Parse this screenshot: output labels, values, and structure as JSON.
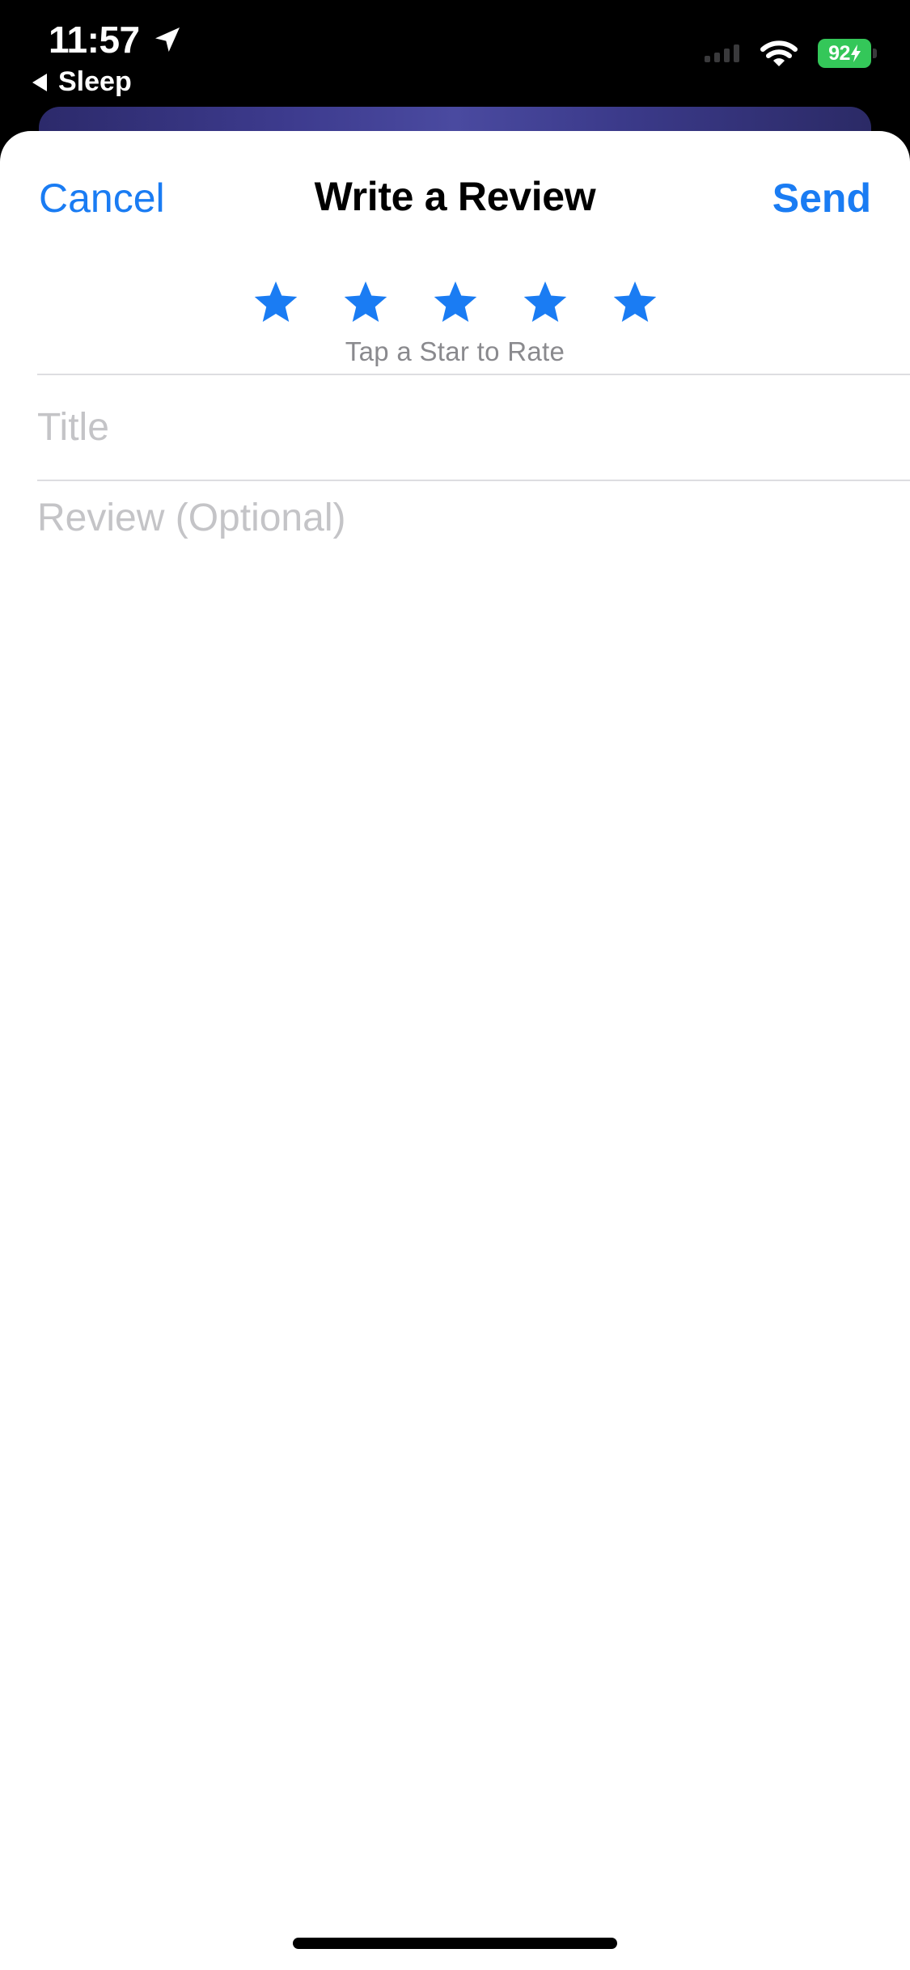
{
  "status_bar": {
    "time": "11:57",
    "location_icon": "location-arrow-icon",
    "back_label": "Sleep",
    "signal_icon": "cellular-signal-icon",
    "wifi_icon": "wifi-icon",
    "battery_level": "92",
    "battery_charging": true,
    "battery_color": "#34C759"
  },
  "nav": {
    "cancel_label": "Cancel",
    "title": "Write a Review",
    "send_label": "Send"
  },
  "rating": {
    "max_stars": 5,
    "selected": 0,
    "hint": "Tap a Star to Rate",
    "star_color": "#1A7CF3"
  },
  "form": {
    "title_placeholder": "Title",
    "title_value": "",
    "review_placeholder": "Review (Optional)",
    "review_value": ""
  },
  "colors": {
    "accent": "#1A7CF3",
    "placeholder": "#C4C4C7",
    "divider": "#DDDDE1"
  }
}
